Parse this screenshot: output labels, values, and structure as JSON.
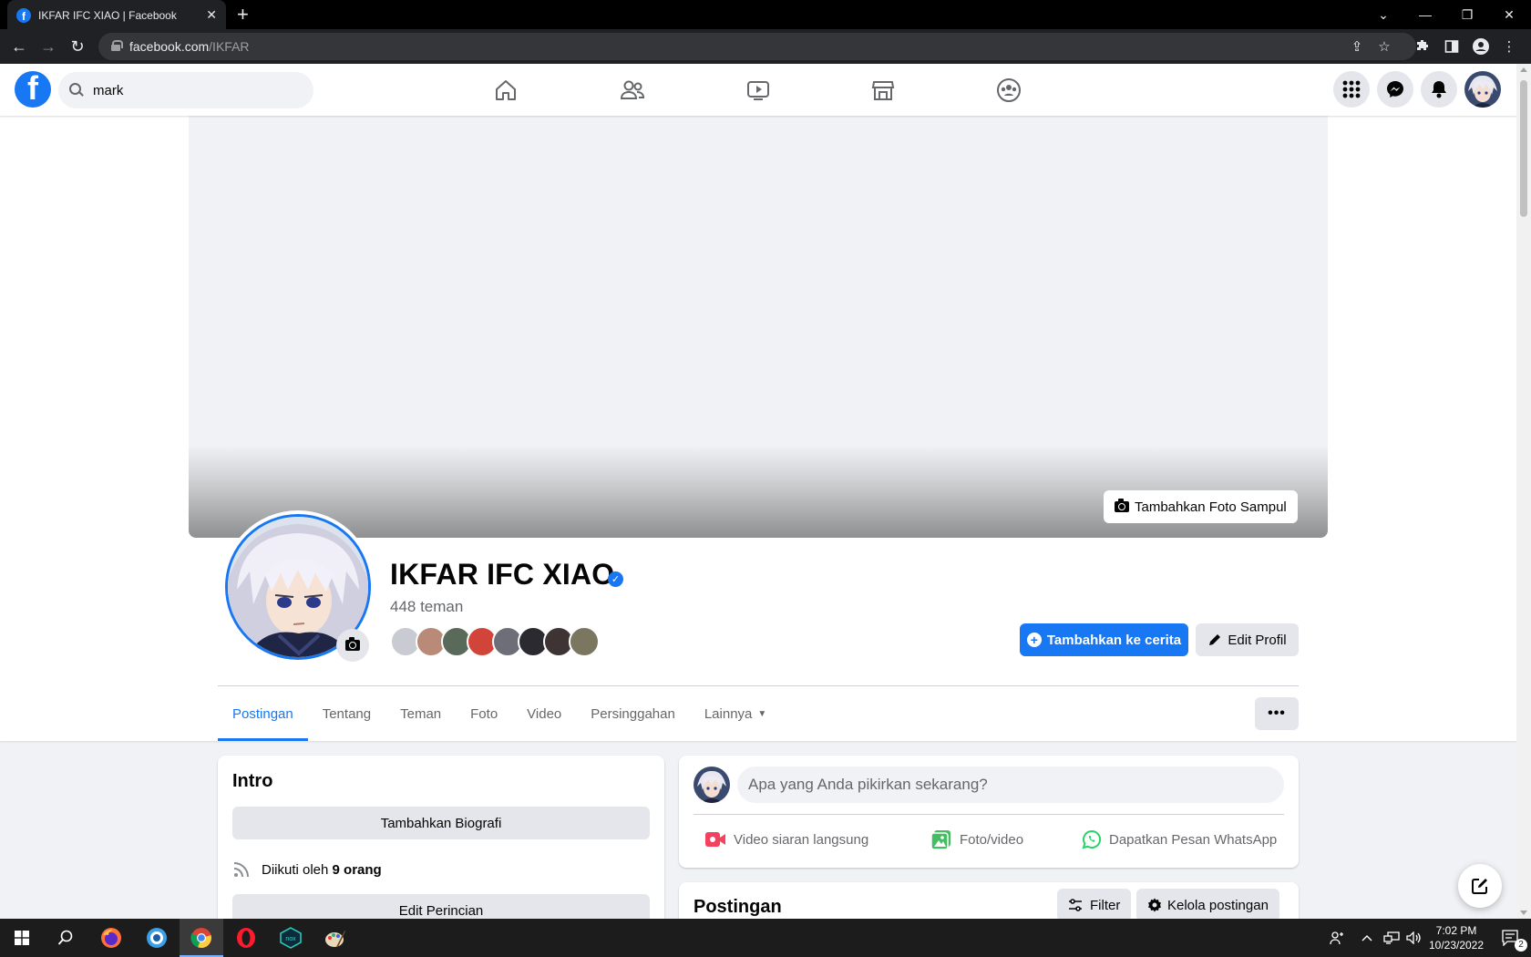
{
  "browser": {
    "tab_title": "IKFAR IFC XIAO | Facebook",
    "url_domain": "facebook.com",
    "url_path": "/IKFAR",
    "new_tab": "+"
  },
  "header": {
    "search_value": "mark",
    "nav_icons": [
      "home-icon",
      "friends-icon",
      "watch-icon",
      "marketplace-icon",
      "groups-icon"
    ],
    "right_icons": [
      "menu-grid-icon",
      "messenger-icon",
      "notifications-icon"
    ]
  },
  "profile": {
    "add_cover_label": "Tambahkan Foto Sampul",
    "name": "IKFAR IFC XIAO",
    "verified_mark": "✓",
    "friends_count": "448 teman",
    "add_story_label": "Tambahkan ke cerita",
    "edit_profile_label": "Edit Profil",
    "tabs": [
      "Postingan",
      "Tentang",
      "Teman",
      "Foto",
      "Video",
      "Persinggahan",
      "Lainnya"
    ],
    "active_tab": "Postingan",
    "more_label": "•••"
  },
  "intro": {
    "title": "Intro",
    "add_bio_label": "Tambahkan Biografi",
    "followed_by_prefix": "Diikuti oleh",
    "followed_by_count": "9 orang",
    "edit_details_label": "Edit Perincian"
  },
  "composer": {
    "placeholder": "Apa yang Anda pikirkan sekarang?",
    "actions": [
      "Video siaran langsung",
      "Foto/video",
      "Dapatkan Pesan WhatsApp"
    ]
  },
  "posts": {
    "title": "Postingan",
    "filter_label": "Filter",
    "manage_label": "Kelola postingan"
  },
  "taskbar": {
    "time": "7:02 PM",
    "date": "10/23/2022",
    "notif_count": "2"
  },
  "colors": {
    "brand": "#1877f2",
    "text_secondary": "#65676b",
    "button_gray": "#e4e6eb",
    "page_bg": "#f0f2f5"
  }
}
